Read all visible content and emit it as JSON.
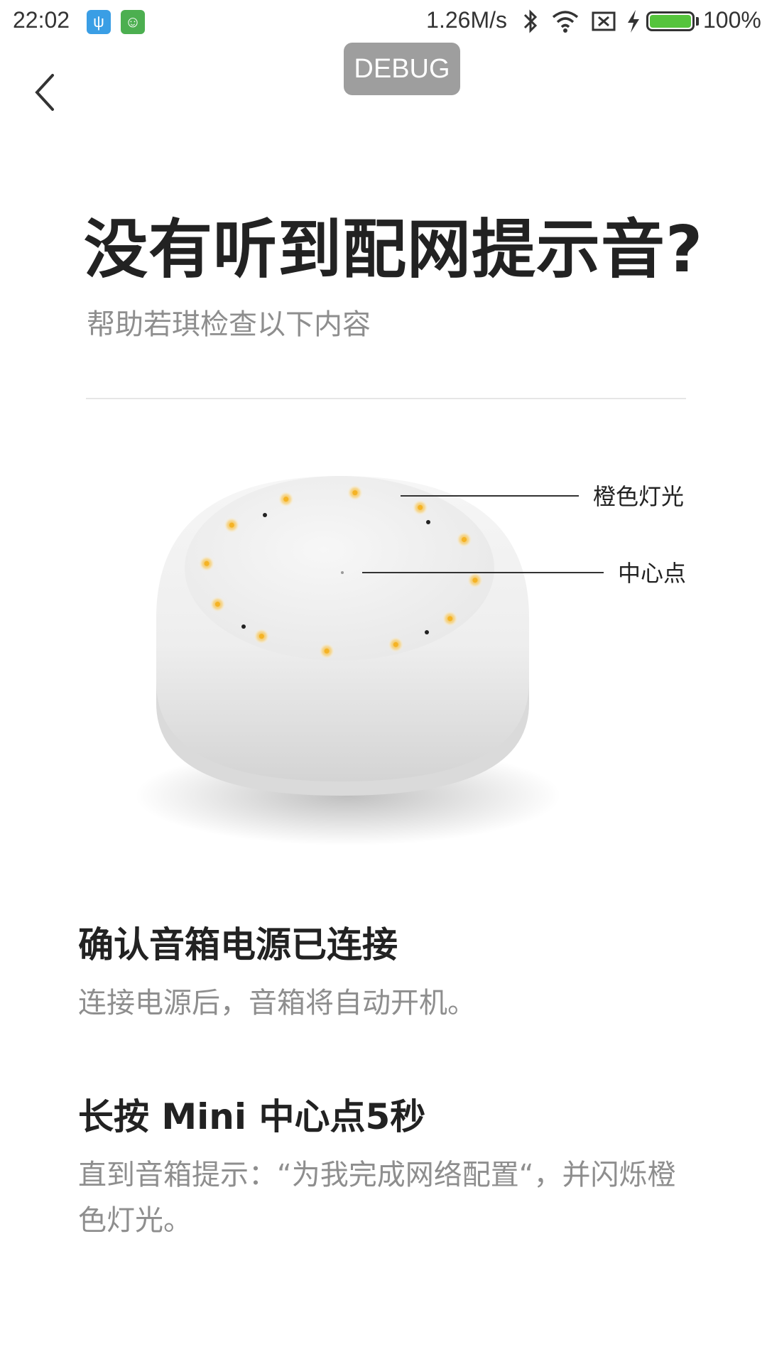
{
  "status_bar": {
    "time": "22:02",
    "network_speed": "1.26M/s",
    "battery_level": "100%",
    "icons": [
      "usb-icon",
      "android-debug-icon",
      "bluetooth-icon",
      "wifi-icon",
      "sim-off-icon",
      "charging-bolt-icon",
      "battery-icon"
    ]
  },
  "header": {
    "back_icon": "chevron-left-icon",
    "debug_label": "DEBUG"
  },
  "main": {
    "title": "没有听到配网提示音?",
    "subtitle": "帮助若琪检查以下内容"
  },
  "illustration": {
    "label_orange_light": "橙色灯光",
    "label_center_point": "中心点",
    "led_color": "#f5b324"
  },
  "steps": [
    {
      "heading": "确认音箱电源已连接",
      "text": "连接电源后，音箱将自动开机。"
    },
    {
      "heading": "长按 Mini 中心点5秒",
      "text": "直到音箱提示：“为我完成网络配置“，并闪烁橙色灯光。"
    }
  ],
  "colors": {
    "battery_fill": "#55c43c",
    "debug_badge": "#9e9e9e",
    "muted_text": "#8e8e8e"
  }
}
